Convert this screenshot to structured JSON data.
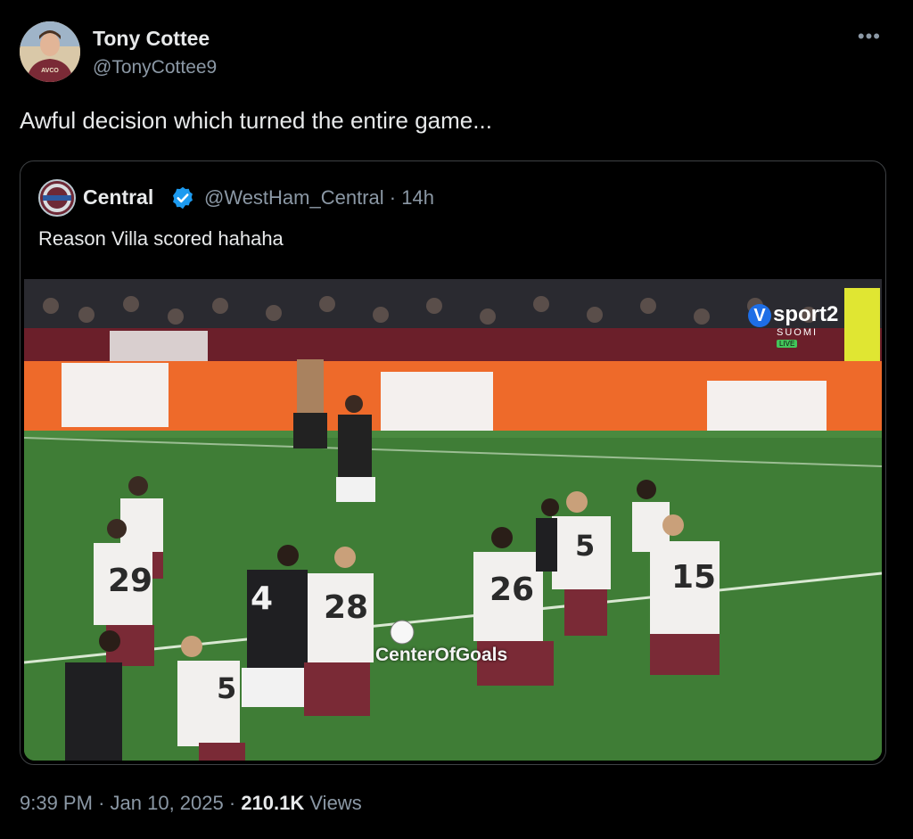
{
  "author": {
    "name": "Tony Cottee",
    "handle": "@TonyCottee9",
    "avatar_icon": "player-avatar",
    "avatar_shirt_text": "AVCO"
  },
  "tweet": {
    "text": "Awful decision which turned the entire game..."
  },
  "quoted_tweet": {
    "name": "Central",
    "handle": "@WestHam_Central",
    "time": "14h",
    "text": "Reason Villa scored hahaha",
    "verified_color": "#1d9bf0",
    "media": {
      "watermark": "CenterOfGoals",
      "broadcaster_logo": "sport2",
      "broadcaster_sub": "SUOMI",
      "broadcaster_live": "LIVE",
      "shirt_numbers": [
        "29",
        "4",
        "28",
        "26",
        "5",
        "15",
        "5"
      ]
    }
  },
  "footer": {
    "time": "9:39 PM",
    "date": "Jan 10, 2025",
    "views_count": "210.1K",
    "views_label": "Views",
    "separator": "·"
  },
  "colors": {
    "background": "#000000",
    "text_primary": "#e7e9ea",
    "text_secondary": "#8b98a5",
    "border": "#3e4144"
  }
}
